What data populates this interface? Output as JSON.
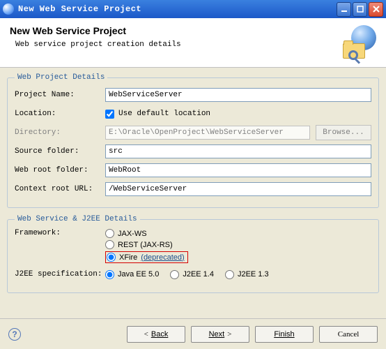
{
  "window": {
    "title": "New Web Service Project"
  },
  "header": {
    "title": "New Web Service Project",
    "subtitle": "Web service project creation details"
  },
  "group1": {
    "legend": "Web Project Details",
    "project_name_label": "Project Name:",
    "project_name_value": "WebServiceServer",
    "location_label": "Location:",
    "use_default_label": "Use default location",
    "directory_label": "Directory:",
    "directory_value": "E:\\Oracle\\OpenProject\\WebServiceServer",
    "browse_label": "Browse...",
    "source_folder_label": "Source folder:",
    "source_folder_value": "src",
    "web_root_label": "Web root folder:",
    "web_root_value": "WebRoot",
    "context_label": "Context root URL:",
    "context_value": "/WebServiceServer"
  },
  "group2": {
    "legend": "Web Service & J2EE Details",
    "framework_label": "Framework:",
    "jaxws": "JAX-WS",
    "rest": "REST (JAX-RS)",
    "xfire": "XFire",
    "xfire_dep": "(deprecated)",
    "j2ee_label": "J2EE specification:",
    "javaee5": "Java EE 5.0",
    "j2ee14": "J2EE 1.4",
    "j2ee13": "J2EE 1.3"
  },
  "footer": {
    "back": "Back",
    "next": "Next",
    "finish": "Finish",
    "cancel": "Cancel"
  }
}
